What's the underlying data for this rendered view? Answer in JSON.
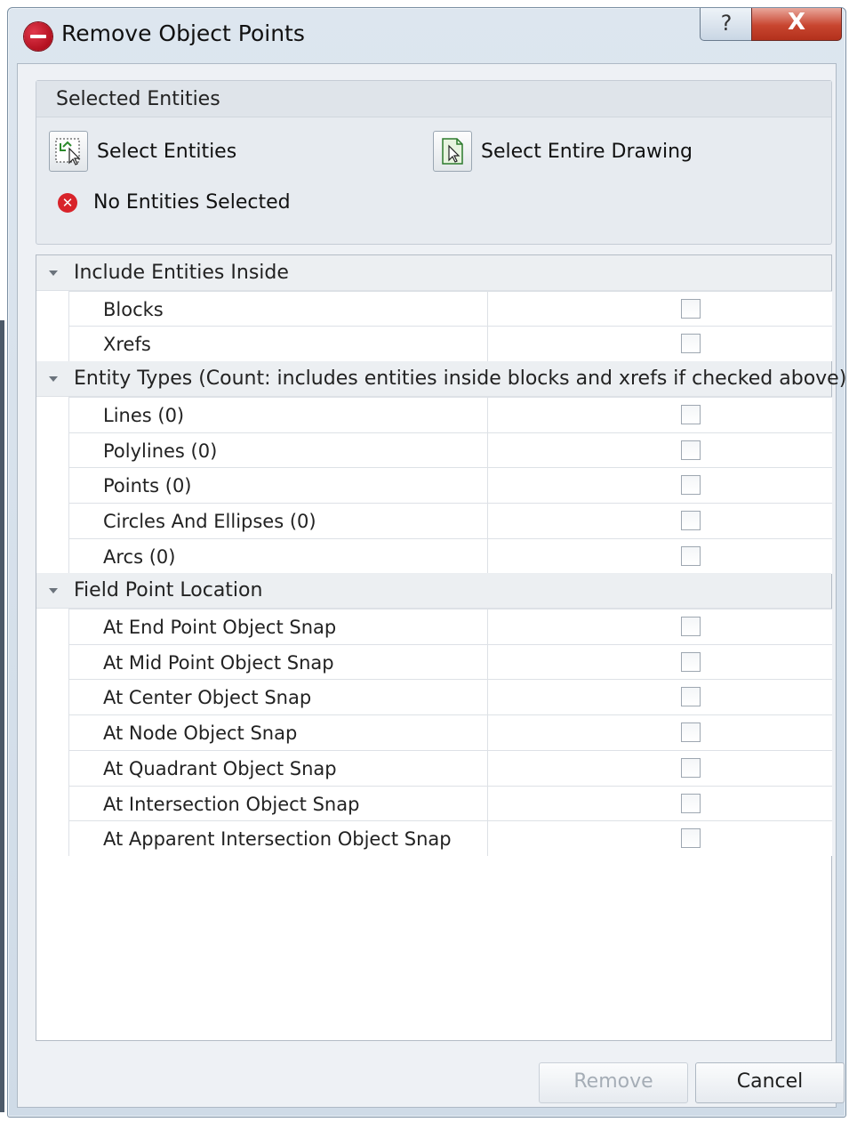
{
  "window": {
    "title": "Remove Object Points",
    "help_glyph": "?",
    "close_glyph": "X"
  },
  "selected_entities": {
    "header": "Selected Entities",
    "select_entities_label": "Select Entities",
    "select_entire_drawing_label": "Select Entire Drawing",
    "status_text": "No Entities Selected",
    "status_icon": "error-icon"
  },
  "property_grid": {
    "categories": [
      {
        "label": "Include Entities Inside",
        "items": [
          {
            "label": "Blocks",
            "checked": false
          },
          {
            "label": "Xrefs",
            "checked": false
          }
        ]
      },
      {
        "label": "Entity Types (Count: includes entities inside blocks and xrefs if checked above)",
        "items": [
          {
            "label": "Lines  (0)",
            "checked": false
          },
          {
            "label": "Polylines  (0)",
            "checked": false
          },
          {
            "label": "Points  (0)",
            "checked": false
          },
          {
            "label": "Circles And Ellipses  (0)",
            "checked": false
          },
          {
            "label": "Arcs  (0)",
            "checked": false
          }
        ]
      },
      {
        "label": "Field Point Location",
        "items": [
          {
            "label": "At End Point Object Snap",
            "checked": false
          },
          {
            "label": "At Mid Point Object Snap",
            "checked": false
          },
          {
            "label": "At Center Object Snap",
            "checked": false
          },
          {
            "label": "At Node Object Snap",
            "checked": false
          },
          {
            "label": "At Quadrant Object Snap",
            "checked": false
          },
          {
            "label": "At Intersection Object Snap",
            "checked": false
          },
          {
            "label": "At Apparent Intersection Object Snap",
            "checked": false
          }
        ]
      }
    ]
  },
  "buttons": {
    "remove_label": "Remove",
    "remove_enabled": false,
    "cancel_label": "Cancel"
  },
  "colors": {
    "accent_red": "#c8452f",
    "error_red": "#d8232a"
  }
}
